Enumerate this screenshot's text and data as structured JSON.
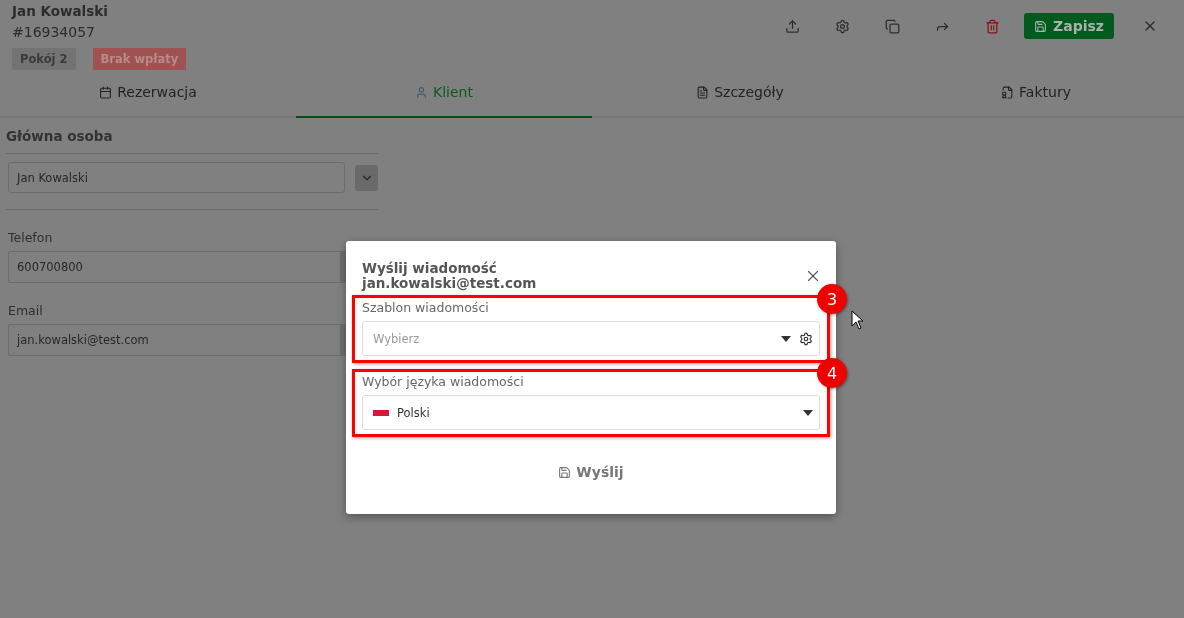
{
  "header": {
    "name": "Jan Kowalski",
    "number": "#16934057",
    "badges": [
      {
        "label": "Pokój 2",
        "kind": "room"
      },
      {
        "label": "Brak wpłaty",
        "kind": "alert"
      }
    ],
    "save_button": "Zapisz"
  },
  "tabs": [
    {
      "label": "Rezerwacja",
      "selected": false
    },
    {
      "label": "Klient",
      "selected": true
    },
    {
      "label": "Szczegóły",
      "selected": false
    },
    {
      "label": "Faktury",
      "selected": false
    }
  ],
  "main_person": {
    "title": "Główna osoba",
    "value": "Jan Kowalski"
  },
  "fields": [
    {
      "label": "Telefon",
      "value": "600700800"
    },
    {
      "label": "Email",
      "value": "jan.kowalski@test.com"
    }
  ],
  "dialog": {
    "title": "Wyślij wiadomość",
    "subtitle": "jan.kowalski@test.com",
    "sections": [
      {
        "callout": "3",
        "label": "Szablon wiadomości",
        "placeholder": "Wybierz",
        "kind": "template"
      },
      {
        "callout": "4",
        "label": "Wybór języka wiadomości",
        "value": "Polski",
        "kind": "language"
      }
    ],
    "send_button": "Wyślij"
  }
}
